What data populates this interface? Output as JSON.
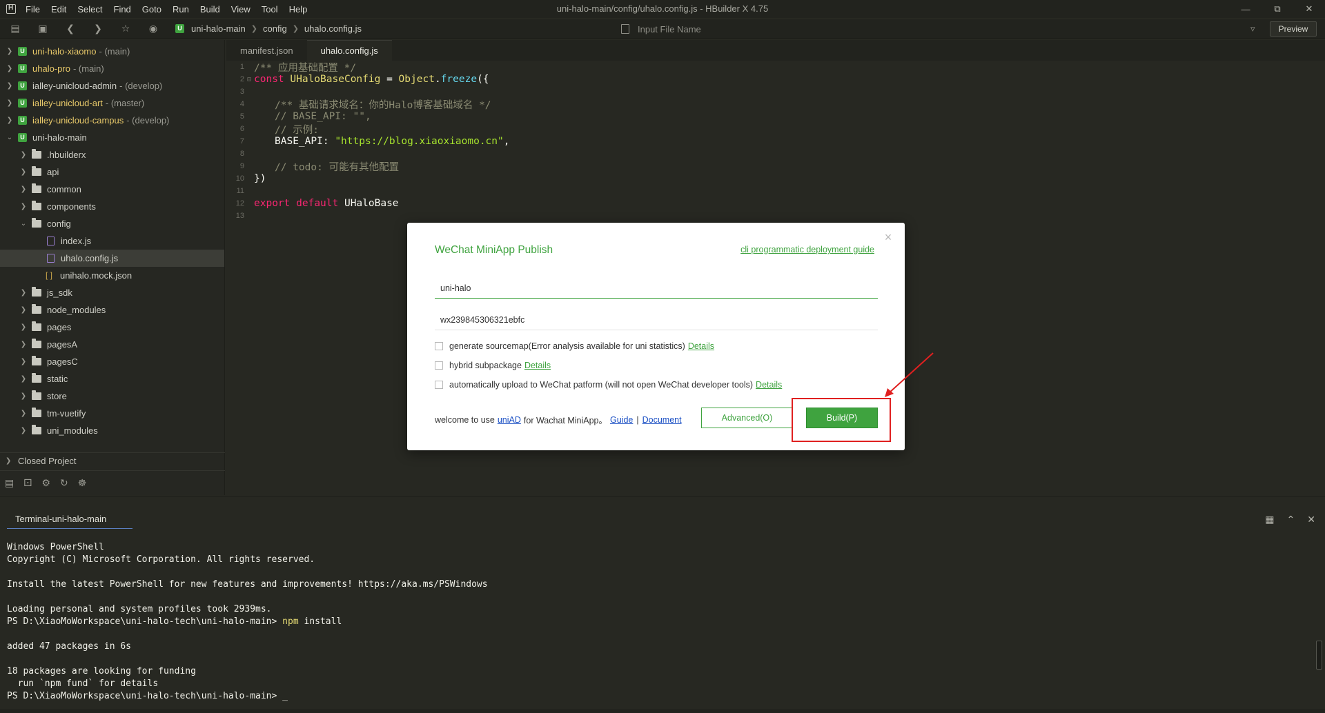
{
  "window": {
    "title": "uni-halo-main/config/uhalo.config.js - HBuilder X 4.75",
    "menu": [
      "File",
      "Edit",
      "Select",
      "Find",
      "Goto",
      "Run",
      "Build",
      "View",
      "Tool",
      "Help"
    ],
    "controls": [
      "minimize-icon",
      "restore-icon",
      "close-icon"
    ]
  },
  "toolbar": {
    "breadcrumb": [
      "uni-halo-main",
      "config",
      "uhalo.config.js"
    ],
    "file_search_placeholder": "Input File Name",
    "preview_label": "Preview"
  },
  "sidebar": {
    "projects": [
      {
        "name": "uni-halo-xiaomo",
        "branch": "- (main)"
      },
      {
        "name": "uhalo-pro",
        "branch": "- (main)"
      },
      {
        "name": "ialley-unicloud-admin",
        "branch": "- (develop)"
      },
      {
        "name": "ialley-unicloud-art",
        "branch": "- (master)"
      },
      {
        "name": "ialley-unicloud-campus",
        "branch": "- (develop)"
      }
    ],
    "main_project": "uni-halo-main",
    "folders_top": [
      ".hbuilderx",
      "api",
      "common",
      "components"
    ],
    "config_folder": "config",
    "config_files": [
      "index.js",
      "uhalo.config.js",
      "unihalo.mock.json"
    ],
    "folders_bottom": [
      "js_sdk",
      "node_modules",
      "pages",
      "pagesA",
      "pagesC",
      "static",
      "store",
      "tm-vuetify",
      "uni_modules"
    ],
    "closed_project": "Closed Project"
  },
  "editor": {
    "tabs": [
      "manifest.json",
      "uhalo.config.js"
    ],
    "line_numbers": [
      "1",
      "2",
      "3",
      "4",
      "5",
      "6",
      "7",
      "8",
      "9",
      "10",
      "11",
      "12",
      "13"
    ],
    "l1": "/** 应用基础配置 */",
    "l2_kw": "const",
    "l2_name": "UHaloBaseConfig",
    "l2_eq": " = ",
    "l2_obj": "Object",
    "l2_dot": ".",
    "l2_fn": "freeze",
    "l2_end": "({",
    "l4": "/** 基础请求域名：你的Halo博客基础域名 */",
    "l5": "// BASE_API: \"\",",
    "l6": "// 示例:",
    "l7_key": "BASE_API",
    "l7_colon": ": ",
    "l7_str": "\"https://blog.xiaoxiaomo.cn\"",
    "l7_comma": ",",
    "l9": "// todo: 可能有其他配置",
    "l10": "})",
    "l12_kw1": "export",
    "l12_kw2": "default",
    "l12_name": "UHaloBase"
  },
  "terminal": {
    "tab": "Terminal-uni-halo-main",
    "lines": [
      "Windows PowerShell",
      "Copyright (C) Microsoft Corporation. All rights reserved.",
      "",
      "Install the latest PowerShell for new features and improvements! https://aka.ms/PSWindows",
      "",
      "Loading personal and system profiles took 2939ms."
    ],
    "prompt": "PS D:\\XiaoMoWorkspace\\uni-halo-tech\\uni-halo-main> ",
    "cmd_npm": "npm",
    "cmd_rest": " install",
    "lines2": [
      "",
      "added 47 packages in 6s",
      "",
      "18 packages are looking for funding",
      "  run `npm fund` for details"
    ],
    "cursor": "_"
  },
  "dialog": {
    "title": "WeChat MiniApp Publish",
    "guide_link": "cli programmatic deployment guide",
    "app_name": "uni-halo",
    "appid": "wx239845306321ebfc",
    "options": [
      {
        "label": "generate sourcemap(Error analysis available for uni statistics)",
        "details": "Details",
        "checked": false
      },
      {
        "label": "hybrid subpackage",
        "details": "Details",
        "checked": false
      },
      {
        "label": "automatically upload to WeChat patform (will not open WeChat developer tools)",
        "details": "Details",
        "checked": false
      }
    ],
    "footer_prefix": "welcome to use",
    "footer_uniad": "uniAD",
    "footer_mid": "for Wachat MiniApp。",
    "footer_guide": "Guide",
    "footer_bar": "|",
    "footer_document": "Document",
    "advanced_label": "Advanced(O)",
    "build_label": "Build(P)"
  },
  "colors": {
    "accent_green": "#3fa33f",
    "annotation_red": "#e02020",
    "editor_bg": "#272822"
  }
}
